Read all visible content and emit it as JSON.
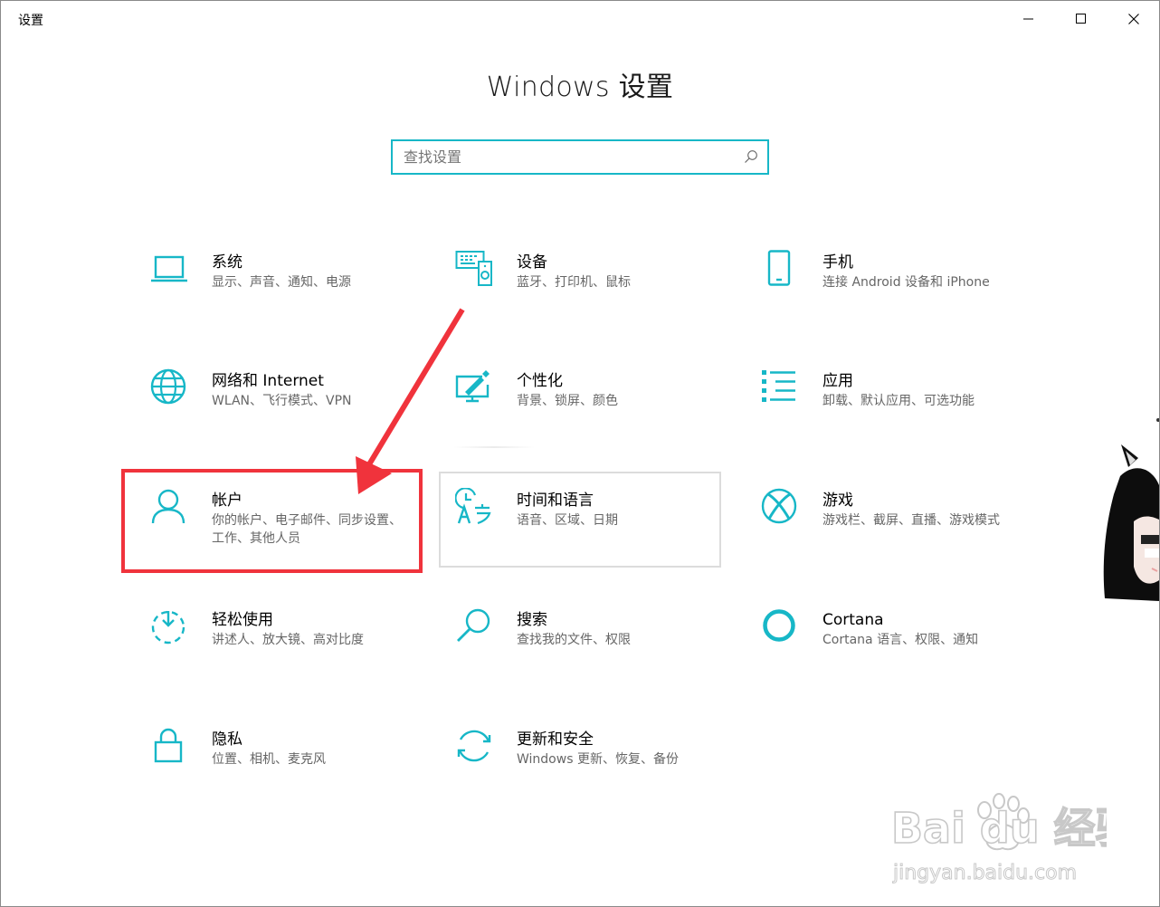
{
  "window": {
    "title": "设置"
  },
  "heading": "Windows 设置",
  "search": {
    "placeholder": "查找设置",
    "value": ""
  },
  "tiles": [
    {
      "title": "系统",
      "desc": "显示、声音、通知、电源",
      "icon": "laptop-icon"
    },
    {
      "title": "设备",
      "desc": "蓝牙、打印机、鼠标",
      "icon": "devices-icon"
    },
    {
      "title": "手机",
      "desc": "连接 Android 设备和 iPhone",
      "icon": "phone-icon"
    },
    {
      "title": "网络和 Internet",
      "desc": "WLAN、飞行模式、VPN",
      "icon": "globe-icon"
    },
    {
      "title": "个性化",
      "desc": "背景、锁屏、颜色",
      "icon": "personalization-icon"
    },
    {
      "title": "应用",
      "desc": "卸载、默认应用、可选功能",
      "icon": "apps-list-icon"
    },
    {
      "title": "帐户",
      "desc": "你的帐户、电子邮件、同步设置、工作、其他人员",
      "icon": "person-icon"
    },
    {
      "title": "时间和语言",
      "desc": "语音、区域、日期",
      "icon": "time-language-icon"
    },
    {
      "title": "游戏",
      "desc": "游戏栏、截屏、直播、游戏模式",
      "icon": "xbox-icon"
    },
    {
      "title": "轻松使用",
      "desc": "讲述人、放大镜、高对比度",
      "icon": "ease-of-access-icon"
    },
    {
      "title": "搜索",
      "desc": "查找我的文件、权限",
      "icon": "search-magnifier-icon"
    },
    {
      "title": "Cortana",
      "desc": "Cortana 语言、权限、通知",
      "icon": "cortana-ring-icon"
    },
    {
      "title": "隐私",
      "desc": "位置、相机、麦克风",
      "icon": "lock-icon"
    },
    {
      "title": "更新和安全",
      "desc": "Windows 更新、恢复、备份",
      "icon": "refresh-icon"
    }
  ],
  "watermark": {
    "brand": "Bai du 经验",
    "url": "jingyan.baidu.com"
  },
  "colors": {
    "accent": "#17b7c7",
    "annotation": "#f0333c",
    "hover_border": "#dcdcdc"
  }
}
